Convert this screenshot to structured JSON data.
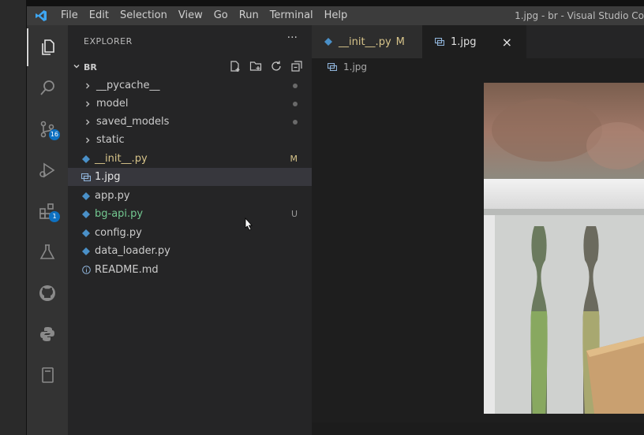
{
  "menubar": {
    "items": [
      "File",
      "Edit",
      "Selection",
      "View",
      "Go",
      "Run",
      "Terminal",
      "Help"
    ],
    "window_title": "1.jpg - br - Visual Studio Co"
  },
  "activity_bar": {
    "source_control_badge": "16",
    "extensions_badge": "1"
  },
  "sidebar": {
    "title": "EXPLORER",
    "more": "···",
    "folder_name": "BR",
    "items": [
      {
        "label": "__pycache__",
        "icon": "chevron-right",
        "decoration": "dot",
        "color": "#cccccc"
      },
      {
        "label": "model",
        "icon": "chevron-right",
        "decoration": "dot",
        "color": "#cccccc"
      },
      {
        "label": "saved_models",
        "icon": "chevron-right",
        "decoration": "dot",
        "color": "#cccccc"
      },
      {
        "label": "static",
        "icon": "chevron-right",
        "decoration": "",
        "color": "#cccccc"
      },
      {
        "label": "__init__.py",
        "icon": "python-file",
        "decoration": "M",
        "color": "#d7c48a"
      },
      {
        "label": "1.jpg",
        "icon": "image-file",
        "decoration": "",
        "color": "#e6e6e6"
      },
      {
        "label": "app.py",
        "icon": "python-file",
        "decoration": "",
        "color": "#cccccc"
      },
      {
        "label": "bg-api.py",
        "icon": "python-file",
        "decoration": "U",
        "color": "#73c991"
      },
      {
        "label": "config.py",
        "icon": "python-file",
        "decoration": "",
        "color": "#cccccc"
      },
      {
        "label": "data_loader.py",
        "icon": "python-file",
        "decoration": "",
        "color": "#cccccc"
      },
      {
        "label": "README.md",
        "icon": "info-file",
        "decoration": "",
        "color": "#cccccc"
      }
    ]
  },
  "tabs": [
    {
      "label": "__init__.py",
      "status": "M",
      "active": false
    },
    {
      "label": "1.jpg",
      "close": "×",
      "active": true
    }
  ],
  "breadcrumb": {
    "file": "1.jpg"
  },
  "colors": {
    "accent": "#0e70c0",
    "modified": "#d7c48a",
    "untracked": "#73c991"
  }
}
